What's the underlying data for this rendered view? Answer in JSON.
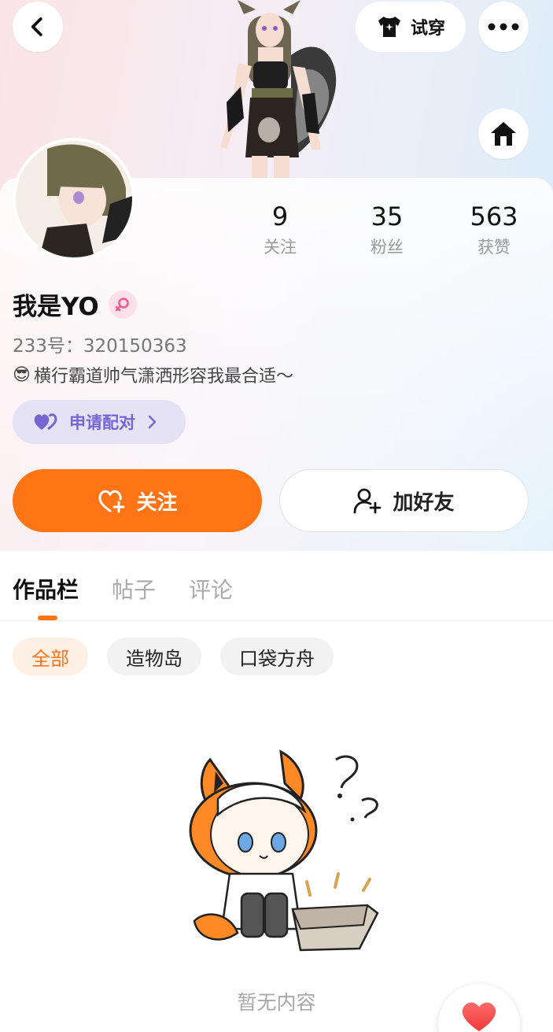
{
  "header": {
    "tryon_label": "试穿"
  },
  "profile": {
    "username": "我是YO",
    "uid": "233号：320150363",
    "bio_emoji": "😎",
    "bio": "横行霸道帅气潇洒形容我最合适～",
    "pair_label": "申请配对"
  },
  "stats": [
    {
      "num": "9",
      "label": "关注"
    },
    {
      "num": "35",
      "label": "粉丝"
    },
    {
      "num": "563",
      "label": "获赞"
    }
  ],
  "actions": {
    "follow_label": "关注",
    "add_friend_label": "加好友"
  },
  "tabs": [
    {
      "label": "作品栏"
    },
    {
      "label": "帖子"
    },
    {
      "label": "评论"
    }
  ],
  "chips": [
    {
      "label": "全部"
    },
    {
      "label": "造物岛"
    },
    {
      "label": "口袋方舟"
    }
  ],
  "empty": {
    "text": "暂无内容"
  },
  "colors": {
    "accent": "#ff7415",
    "pair": "#7566d4"
  }
}
